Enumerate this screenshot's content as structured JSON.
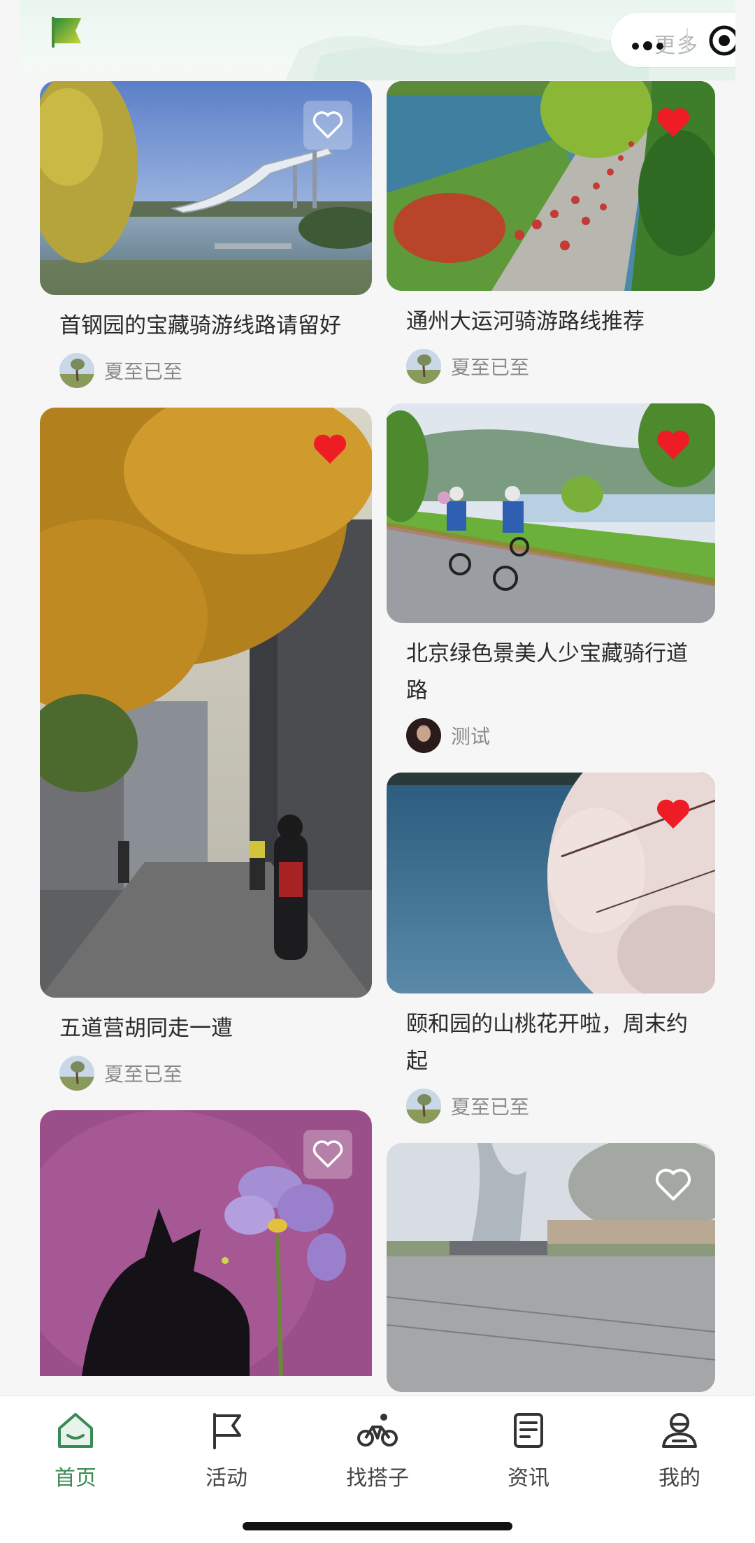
{
  "header": {
    "logo_icon": "green-flag-icon",
    "more_text": "更多",
    "menu_icon": "more-dots-icon",
    "close_icon": "target-circle-icon"
  },
  "feed": {
    "left": [
      {
        "title": "首钢园的宝藏骑游线路请留好",
        "author": "夏至已至",
        "favorited": false,
        "image": "ski-jump-by-lake-photo"
      },
      {
        "title": "五道营胡同走一遭",
        "author": "夏至已至",
        "favorited": true,
        "image": "hutong-autumn-street-photo"
      },
      {
        "title": "",
        "author": "",
        "favorited": false,
        "image": "black-cat-iris-painting"
      }
    ],
    "right": [
      {
        "title": "通州大运河骑游路线推荐",
        "author": "夏至已至",
        "favorited": true,
        "image": "canal-cyclists-photo"
      },
      {
        "title": "北京绿色景美人少宝藏骑行道路",
        "author": "测试",
        "favorited": true,
        "image": "riverside-cyclists-photo"
      },
      {
        "title": "颐和园的山桃花开啦，周末约起",
        "author": "夏至已至",
        "favorited": true,
        "image": "peach-blossom-lake-photo"
      },
      {
        "title": "",
        "author": "",
        "favorited": false,
        "image": "plaza-sculpture-photo"
      }
    ]
  },
  "tabbar": {
    "tabs": [
      {
        "label": "首页",
        "icon": "home-icon",
        "active": true
      },
      {
        "label": "活动",
        "icon": "flag-icon",
        "active": false
      },
      {
        "label": "找搭子",
        "icon": "bicycle-icon",
        "active": false
      },
      {
        "label": "资讯",
        "icon": "news-icon",
        "active": false
      },
      {
        "label": "我的",
        "icon": "profile-icon",
        "active": false
      }
    ]
  },
  "colors": {
    "accent": "#3a8a54",
    "favorite_red": "#ee1c24",
    "background": "#f6f6f6"
  }
}
